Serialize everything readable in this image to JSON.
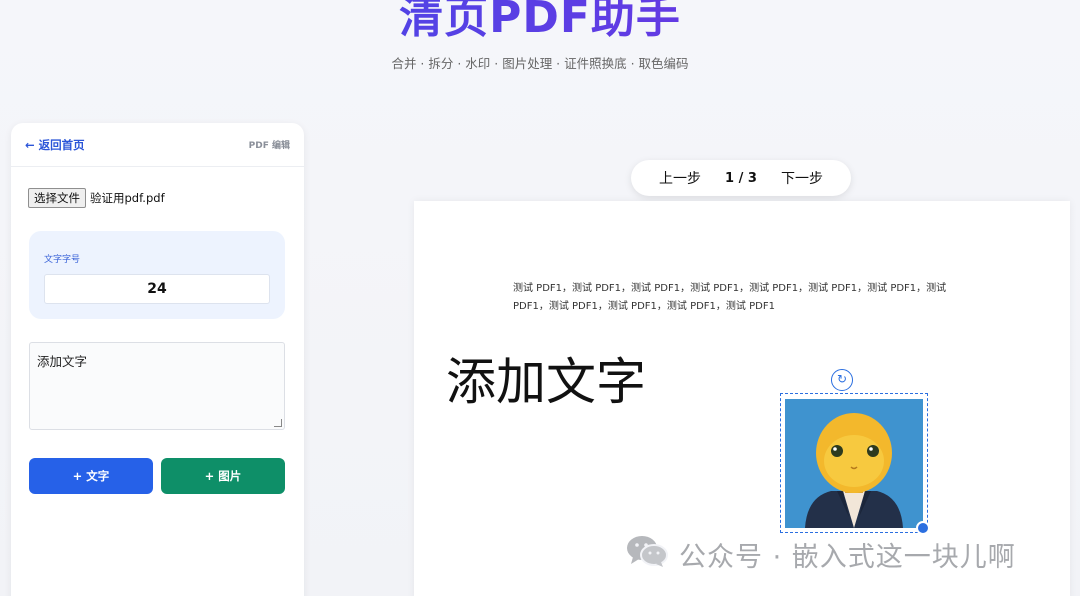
{
  "header": {
    "title": "清页PDF助手",
    "subtitle": "合并 · 拆分 · 水印 · 图片处理 · 证件照换底 · 取色编码"
  },
  "sidebar": {
    "back_label": "← 返回首页",
    "section_label": "PDF 编辑",
    "file_button_label": "选择文件",
    "file_name": "验证用pdf.pdf",
    "font_size_label": "文字字号",
    "font_size_value": "24",
    "text_input_value": "添加文字",
    "add_text_button": "+ 文字",
    "add_image_button": "+ 图片"
  },
  "pager": {
    "prev_label": "上一步",
    "page_indicator": "1 / 3",
    "next_label": "下一步"
  },
  "pdf": {
    "body_text": "测试 PDF1，测试 PDF1，测试 PDF1，测试 PDF1，测试 PDF1，测试 PDF1，测试 PDF1，测试 PDF1，测试 PDF1，测试 PDF1，测试 PDF1，测试 PDF1",
    "added_text": "添加文字"
  },
  "watermark": {
    "text": "公众号 · 嵌入式这一块儿啊"
  },
  "colors": {
    "accent_blue": "#2661e8",
    "accent_green": "#0e8f68",
    "title_gradient_start": "#3b4ee8",
    "title_gradient_end": "#7a2fe0"
  },
  "icons": {
    "rotate": "rotate-icon",
    "wechat": "wechat-icon"
  }
}
